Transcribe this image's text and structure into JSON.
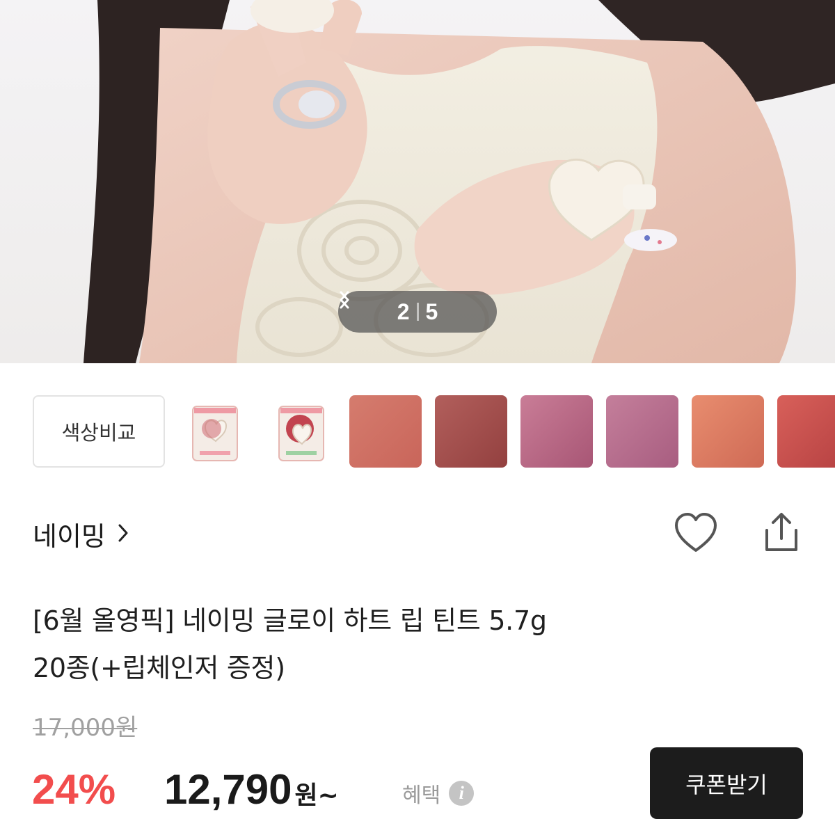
{
  "colors": {
    "accent_discount": "#f24d4d",
    "coupon_bg": "#1c1c1c",
    "swatches": [
      "#cd6f63",
      "#a2504f",
      "#b76a86",
      "#b86d8c",
      "#dc7b61",
      "#c5524f"
    ]
  },
  "gallery": {
    "current": "2",
    "total": "5",
    "prev_icon": "chevron-left-icon",
    "next_icon": "chevron-right-icon"
  },
  "swatch_row": {
    "compare_label": "색상비교"
  },
  "brand": {
    "name": "네이밍",
    "chevron_icon": "chevron-right-icon",
    "wish_icon": "heart-icon",
    "share_icon": "share-icon"
  },
  "product": {
    "title_line1": "[6월 올영픽] 네이밍 글로이 하트 립 틴트 5.7g",
    "title_line2": "20종(+립체인저 증정)"
  },
  "price": {
    "original": "17,000원",
    "discount": "24%",
    "sale_value": "12,790",
    "sale_unit": "원~",
    "benefit_label": "혜택",
    "info_icon": "i",
    "coupon_label": "쿠폰받기"
  }
}
